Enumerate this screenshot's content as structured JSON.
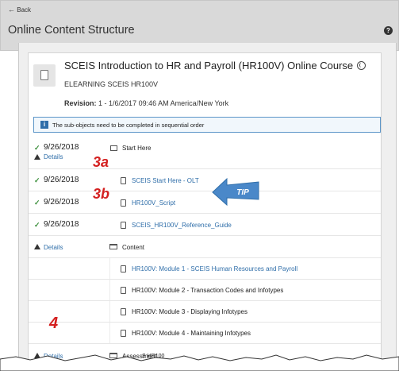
{
  "header": {
    "back_label": "Back",
    "title": "Online Content Structure",
    "help_icon": "?"
  },
  "course": {
    "title": "SCEIS Introduction to HR and Payroll (HR100V) Online Course",
    "code": "ELEARNING SCEIS HR100V",
    "revision_label": "Revision:",
    "revision_value": "1 - 1/6/2017 09:46 AM America/New York"
  },
  "notice": {
    "icon": "i",
    "text": "The sub-objects need to be completed in sequential order"
  },
  "rows": [
    {
      "date": "9/26/2018",
      "details": "Details",
      "label": "Start Here"
    },
    {
      "date": "9/26/2018",
      "label": "SCEIS Start Here - OLT"
    },
    {
      "date": "9/26/2018",
      "label": "HR100V_Script"
    },
    {
      "date": "9/26/2018",
      "label": "SCEIS_HR100V_Reference_Guide"
    }
  ],
  "content_section": {
    "details": "Details",
    "label": "Content",
    "modules": [
      "HR100V: Module 1 - SCEIS Human Resources and Payroll",
      "HR100V: Module 2 - Transaction Codes and Infotypes",
      "HR100V: Module 3 - Displaying Infotypes",
      "HR100V: Module 4 - Maintaining Infotypes"
    ]
  },
  "assessment_section": {
    "details": "Details",
    "label": "Assessment",
    "partial": "S HR100"
  },
  "callouts": {
    "a": "3a",
    "b": "3b",
    "c": "4"
  },
  "tip_label": "TIP",
  "colors": {
    "link": "#2f6ea9",
    "check": "#3b8f3b",
    "callout": "#d42020",
    "tip_arrow": "#4a88c9"
  }
}
